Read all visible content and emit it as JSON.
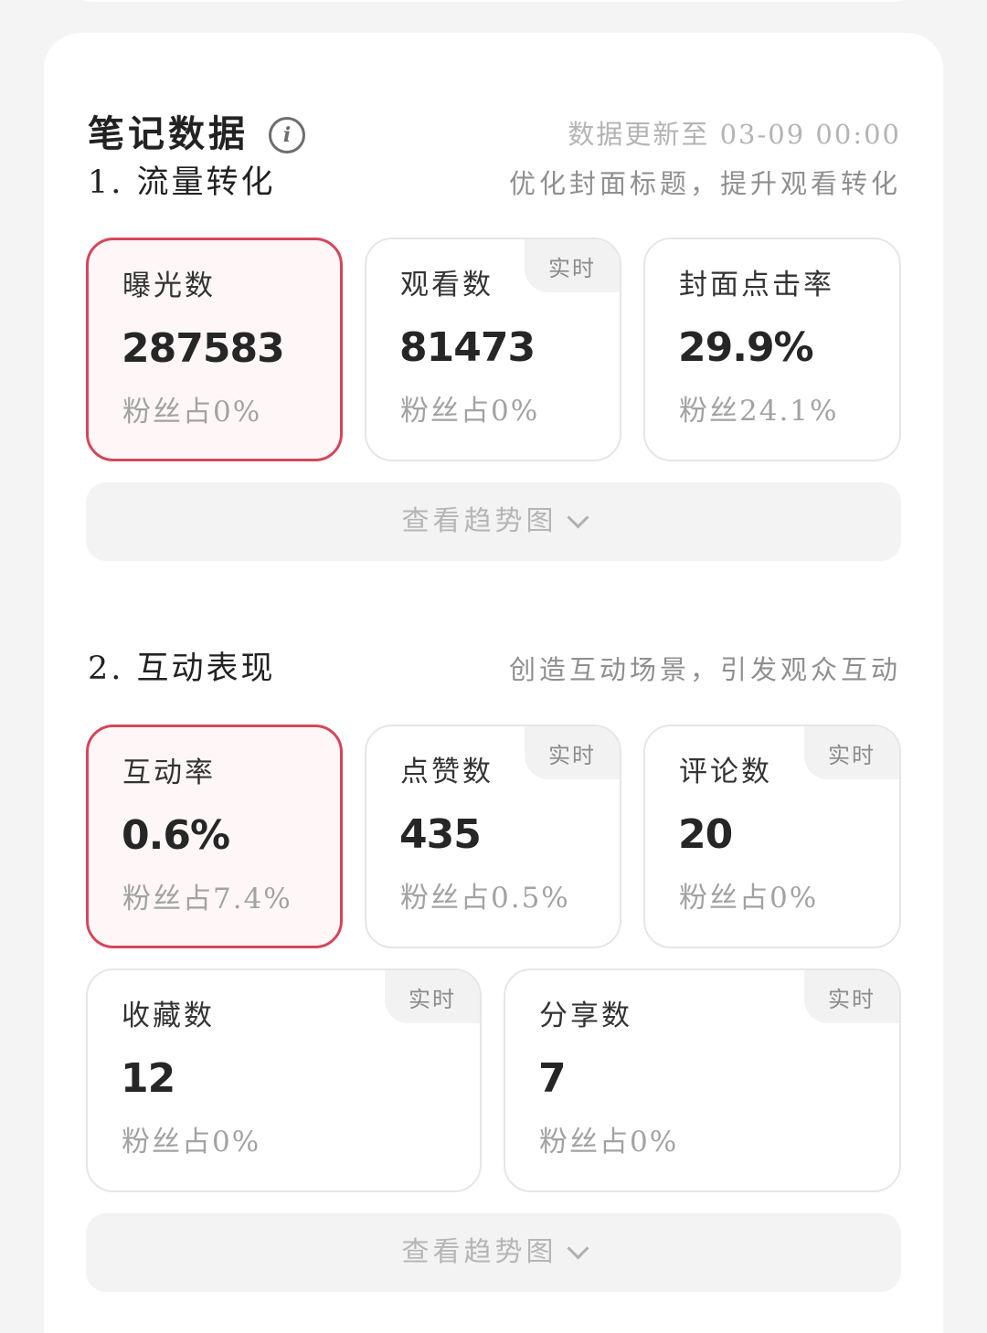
{
  "header": {
    "title": "笔记数据",
    "info_icon": "info-icon",
    "update_text": "数据更新至 03-09 00:00"
  },
  "traffic": {
    "title": "1. 流量转化",
    "hint": "优化封面标题，提升观看转化",
    "metrics": [
      {
        "label": "曝光数",
        "value": "287583",
        "sub": "粉丝占0%",
        "active": true,
        "realtime": ""
      },
      {
        "label": "观看数",
        "value": "81473",
        "sub": "粉丝占0%",
        "active": false,
        "realtime": "实时"
      },
      {
        "label": "封面点击率",
        "value": "29.9%",
        "sub": "粉丝24.1%",
        "active": false,
        "realtime": ""
      }
    ],
    "trend_label": "查看趋势图"
  },
  "interaction": {
    "title": "2. 互动表现",
    "hint": "创造互动场景，引发观众互动",
    "metrics": [
      {
        "label": "互动率",
        "value": "0.6%",
        "sub": "粉丝占7.4%",
        "active": true,
        "realtime": ""
      },
      {
        "label": "点赞数",
        "value": "435",
        "sub": "粉丝占0.5%",
        "active": false,
        "realtime": "实时"
      },
      {
        "label": "评论数",
        "value": "20",
        "sub": "粉丝占0%",
        "active": false,
        "realtime": "实时"
      },
      {
        "label": "收藏数",
        "value": "12",
        "sub": "粉丝占0%",
        "active": false,
        "realtime": "实时"
      },
      {
        "label": "分享数",
        "value": "7",
        "sub": "粉丝占0%",
        "active": false,
        "realtime": "实时"
      }
    ],
    "trend_label": "查看趋势图"
  },
  "colors": {
    "accent": "#d6455a",
    "active_bg": "#fff7f7",
    "card_bg": "#ffffff",
    "page_bg": "#f4f4f4"
  }
}
